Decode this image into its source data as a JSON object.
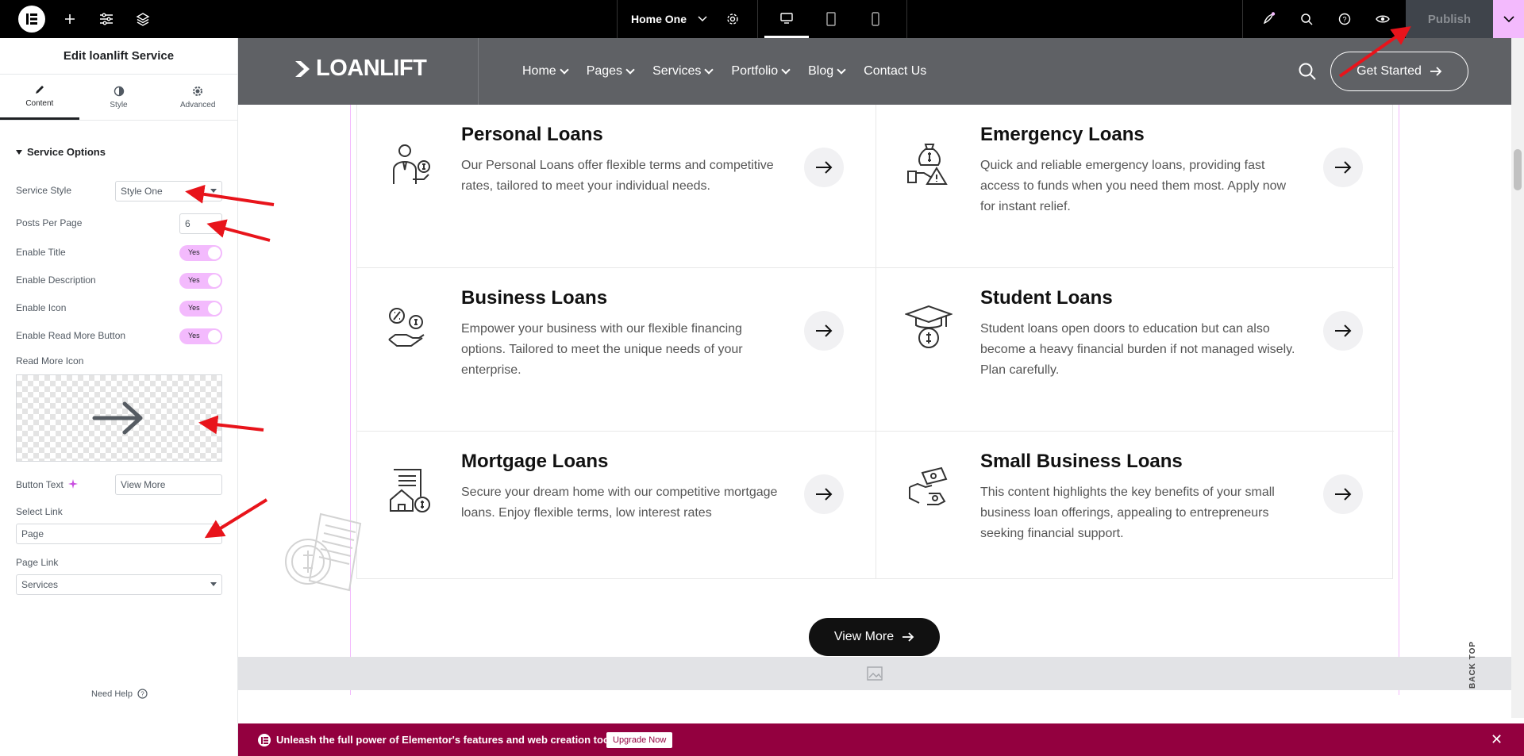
{
  "topbar": {
    "document_title": "Home One",
    "publish_label": "Publish"
  },
  "panel": {
    "header": "Edit loanlift Service",
    "tabs": [
      {
        "label": "Content"
      },
      {
        "label": "Style"
      },
      {
        "label": "Advanced"
      }
    ],
    "section_title": "Service Options",
    "service_style": {
      "label": "Service Style",
      "value": "Style One"
    },
    "posts_per_page": {
      "label": "Posts Per Page",
      "value": "6"
    },
    "toggles": [
      {
        "label": "Enable Title",
        "state": "Yes"
      },
      {
        "label": "Enable Description",
        "state": "Yes"
      },
      {
        "label": "Enable Icon",
        "state": "Yes"
      },
      {
        "label": "Enable Read More Button",
        "state": "Yes"
      }
    ],
    "read_more_icon_label": "Read More Icon",
    "button_text": {
      "label": "Button Text",
      "value": "View More"
    },
    "select_link": {
      "label": "Select Link",
      "value": "Page"
    },
    "page_link": {
      "label": "Page Link",
      "value": "Services"
    },
    "need_help": "Need Help"
  },
  "site": {
    "logo_text": "LOANLIFT",
    "nav": [
      "Home",
      "Pages",
      "Services",
      "Portfolio",
      "Blog",
      "Contact Us"
    ],
    "nav_dropdown": [
      true,
      true,
      true,
      true,
      true,
      false
    ],
    "cta_label": "Get Started",
    "cards": [
      {
        "title": "Personal Loans",
        "description": "Our Personal Loans offer flexible terms and competitive rates, tailored to meet your individual needs.",
        "icon": "personal-loan-icon"
      },
      {
        "title": "Emergency Loans",
        "description": "Quick and reliable emergency loans, providing fast access to funds when you need them most. Apply now for instant relief.",
        "icon": "emergency-loan-icon"
      },
      {
        "title": "Business Loans",
        "description": "Empower your business with our flexible financing options. Tailored to meet the unique needs of your enterprise.",
        "icon": "business-loan-icon"
      },
      {
        "title": "Student Loans",
        "description": "Student loans open doors to education but can also become a heavy financial burden if not managed wisely. Plan carefully.",
        "icon": "student-loan-icon"
      },
      {
        "title": "Mortgage Loans",
        "description": "Secure your dream home with our competitive mortgage loans. Enjoy flexible terms, low interest rates",
        "icon": "mortgage-loan-icon"
      },
      {
        "title": "Small Business Loans",
        "description": "This content highlights the key benefits of your small business loan offerings, appealing to entrepreneurs seeking financial support.",
        "icon": "small-business-loan-icon"
      }
    ],
    "view_more_label": "View More",
    "back_top_label": "BACK TOP"
  },
  "promo": {
    "text": "Unleash the full power of Elementor's features and web creation tools.",
    "button": "Upgrade Now"
  },
  "colors": {
    "accent_pink": "#f3bafd",
    "promo_bg": "#93003f",
    "annotation_red": "#e8141b"
  }
}
